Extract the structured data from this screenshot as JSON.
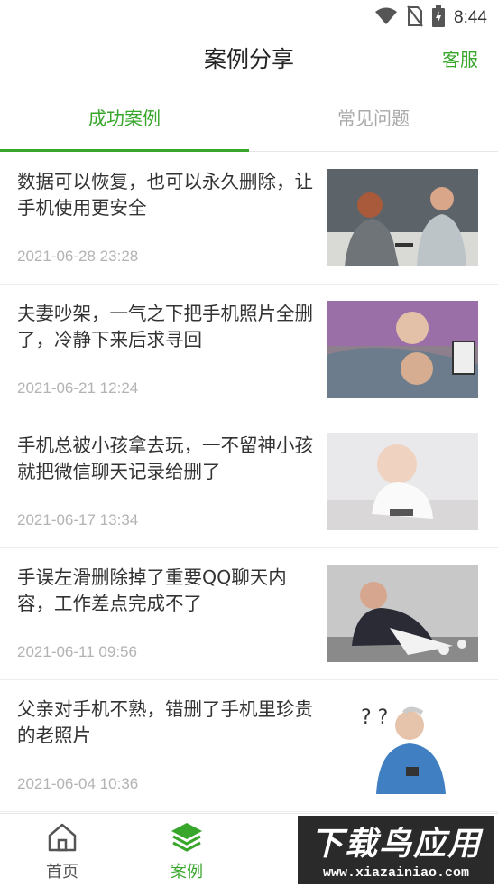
{
  "status_bar": {
    "time": "8:44",
    "icons": [
      "wifi-icon",
      "no-sim-icon",
      "battery-charging-icon"
    ]
  },
  "header": {
    "title": "案例分享",
    "service_label": "客服"
  },
  "tabs": [
    {
      "label": "成功案例",
      "active": true
    },
    {
      "label": "常见问题",
      "active": false
    }
  ],
  "cases": [
    {
      "title": "数据可以恢复，也可以永久删除，让手机使用更安全",
      "date": "2021-06-28 23:28"
    },
    {
      "title": "夫妻吵架，一气之下把手机照片全删了，冷静下来后求寻回",
      "date": "2021-06-21 12:24"
    },
    {
      "title": "手机总被小孩拿去玩，一不留神小孩就把微信聊天记录给删了",
      "date": "2021-06-17 13:34"
    },
    {
      "title": "手误左滑删除掉了重要QQ聊天内容，工作差点完成不了",
      "date": "2021-06-11 09:56"
    },
    {
      "title": "父亲对手机不熟，错删了手机里珍贵的老照片",
      "date": "2021-06-04 10:36"
    }
  ],
  "bottom_nav": [
    {
      "label": "首页",
      "icon": "home-icon",
      "active": false
    },
    {
      "label": "案例",
      "icon": "layers-icon",
      "active": true
    },
    {
      "label": "",
      "icon": "",
      "active": false
    }
  ],
  "watermark": {
    "top": "下载鸟应用",
    "bottom": "www.xiazainiao.com"
  },
  "colors": {
    "accent": "#37a62a",
    "text": "#333333",
    "muted": "#b3b3b3"
  }
}
